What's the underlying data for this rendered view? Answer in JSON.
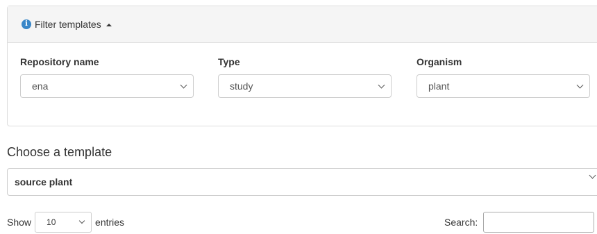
{
  "filter_panel": {
    "title": "Filter templates",
    "icon": "info-icon",
    "expanded": true,
    "fields": [
      {
        "label": "Repository name",
        "value": "ena"
      },
      {
        "label": "Type",
        "value": "study"
      },
      {
        "label": "Organism",
        "value": "plant"
      }
    ]
  },
  "template_chooser": {
    "heading": "Choose a template",
    "selected": "source plant"
  },
  "table_controls": {
    "show_label": "Show",
    "page_length": "10",
    "entries_label": "entries",
    "search_label": "Search:",
    "search_value": ""
  },
  "colors": {
    "info_accent": "#3a87c8",
    "panel_heading_bg": "#f5f5f5",
    "border": "#dddddd"
  }
}
